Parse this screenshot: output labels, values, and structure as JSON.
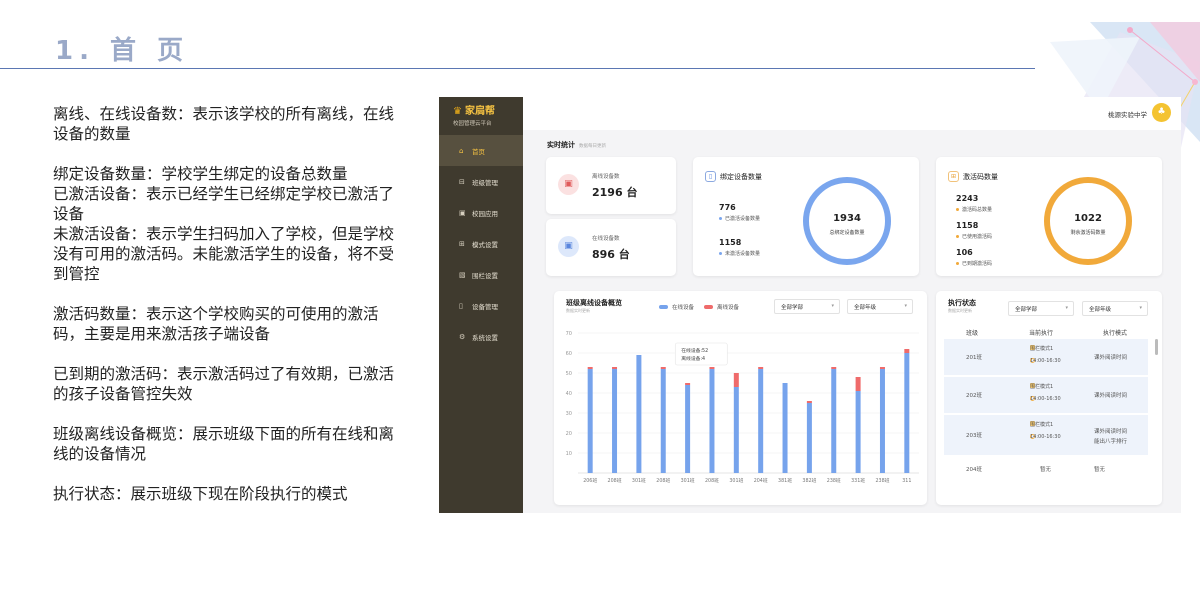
{
  "slide": {
    "title": "1. 首 页",
    "paragraphs": [
      "离线、在线设备数：表示该学校的所有离线，在线设备的数量",
      "绑定设备数量：学校学生绑定的设备总数量",
      "已激活设备：表示已经学生已经绑定学校已激活了设备",
      "未激活设备：表示学生扫码加入了学校，但是学校没有可用的激活码。未能激活学生的设备，将不受到管控",
      "激活码数量：表示这个学校购买的可使用的激活码，主要是用来激活孩子端设备",
      "已到期的激活码：表示激活码过了有效期，已激活的孩子设备管控失效",
      "班级离线设备概览：展示班级下面的所有在线和离线的设备情况",
      "执行状态：展示班级下现在阶段执行的模式"
    ]
  },
  "app": {
    "brand": "家扃帮",
    "brand_sub": "校园管理云平台",
    "school": "桃源实验中学",
    "nav": [
      {
        "label": "首页",
        "icon": "home-icon",
        "glyph": "⌂",
        "active": true
      },
      {
        "label": "班级管理",
        "icon": "class-icon",
        "glyph": "⊟",
        "active": false
      },
      {
        "label": "校园应用",
        "icon": "app-icon",
        "glyph": "▣",
        "active": false
      },
      {
        "label": "模式设置",
        "icon": "mode-icon",
        "glyph": "⊞",
        "active": false
      },
      {
        "label": "围栏设置",
        "icon": "fence-icon",
        "glyph": "▧",
        "active": false
      },
      {
        "label": "设备管理",
        "icon": "device-icon",
        "glyph": "▯",
        "active": false
      },
      {
        "label": "系统设置",
        "icon": "settings-icon",
        "glyph": "⚙",
        "active": false
      }
    ],
    "realtime": {
      "title": "实时统计",
      "sub": "数据每日更新"
    },
    "offline": {
      "label": "离线设备数",
      "value": "2196 台"
    },
    "online": {
      "label": "在线设备数",
      "value": "896 台"
    },
    "bound": {
      "title": "绑定设备数量",
      "activated_num": "776",
      "activated_label": "已激活设备数量",
      "inactive_num": "1158",
      "inactive_label": "未激活设备数量",
      "total": "1934",
      "total_label": "总绑定设备数量"
    },
    "codes": {
      "title": "激活码数量",
      "total_num": "2243",
      "total_label": "激活码总数量",
      "used_num": "1158",
      "used_label": "已使用激活码",
      "expired_num": "106",
      "expired_label": "已到期激活码",
      "remain": "1022",
      "remain_label": "剩余激活码数量"
    },
    "chart_panel": {
      "title": "班级离线设备概览",
      "sub": "数据实时更新",
      "legend_online": "在线设备",
      "legend_offline": "离线设备",
      "select_semester": "全部学部",
      "select_grade": "全部年级",
      "tooltip_online": "在线设备:52",
      "tooltip_offline": "离线设备:4"
    },
    "status_panel": {
      "title": "执行状态",
      "sub": "数据实时更新",
      "select_semester": "全部学部",
      "select_grade": "全部年级",
      "col_class": "班级",
      "col_current": "当前执行",
      "col_mode": "执行模式",
      "rows": [
        {
          "class": "201班",
          "current": "围栏模式1",
          "time": "14:00-16:30",
          "mode": "课外阅读时间",
          "mode2": ""
        },
        {
          "class": "202班",
          "current": "围栏模式1",
          "time": "14:00-16:30",
          "mode": "课外阅读时间",
          "mode2": ""
        },
        {
          "class": "203班",
          "current": "围栏模式1",
          "time": "14:00-16:30",
          "mode": "课外阅读时间",
          "mode2": "能出八字排行"
        },
        {
          "class": "204班",
          "current": "暂无",
          "time": "",
          "mode": "暂无",
          "mode2": ""
        }
      ]
    }
  },
  "colors": {
    "online": "#76a3ec",
    "offline": "#ef6b6b",
    "ring_blue": "#7aa6ee",
    "ring_orange": "#f1a93a",
    "sidebar": "#3f3a2e",
    "accent": "#f5c242"
  },
  "chart_data": {
    "type": "bar",
    "stacked": true,
    "categories": [
      "206班",
      "208班",
      "301班",
      "208班",
      "301班",
      "208班",
      "301班",
      "204班",
      "381班",
      "382班",
      "238班",
      "331班",
      "238班",
      "311"
    ],
    "series": [
      {
        "name": "在线设备",
        "values": [
          52,
          52,
          59,
          52,
          44,
          52,
          43,
          52,
          45,
          35,
          52,
          41,
          52,
          60
        ]
      },
      {
        "name": "离线设备",
        "values": [
          1,
          1,
          0,
          1,
          1,
          1,
          7,
          1,
          0,
          1,
          1,
          7,
          1,
          2
        ]
      }
    ],
    "ylim": [
      0,
      70
    ],
    "yticks": [
      10,
      20,
      30,
      40,
      50,
      60,
      70
    ],
    "grid": true,
    "legend": "top"
  }
}
